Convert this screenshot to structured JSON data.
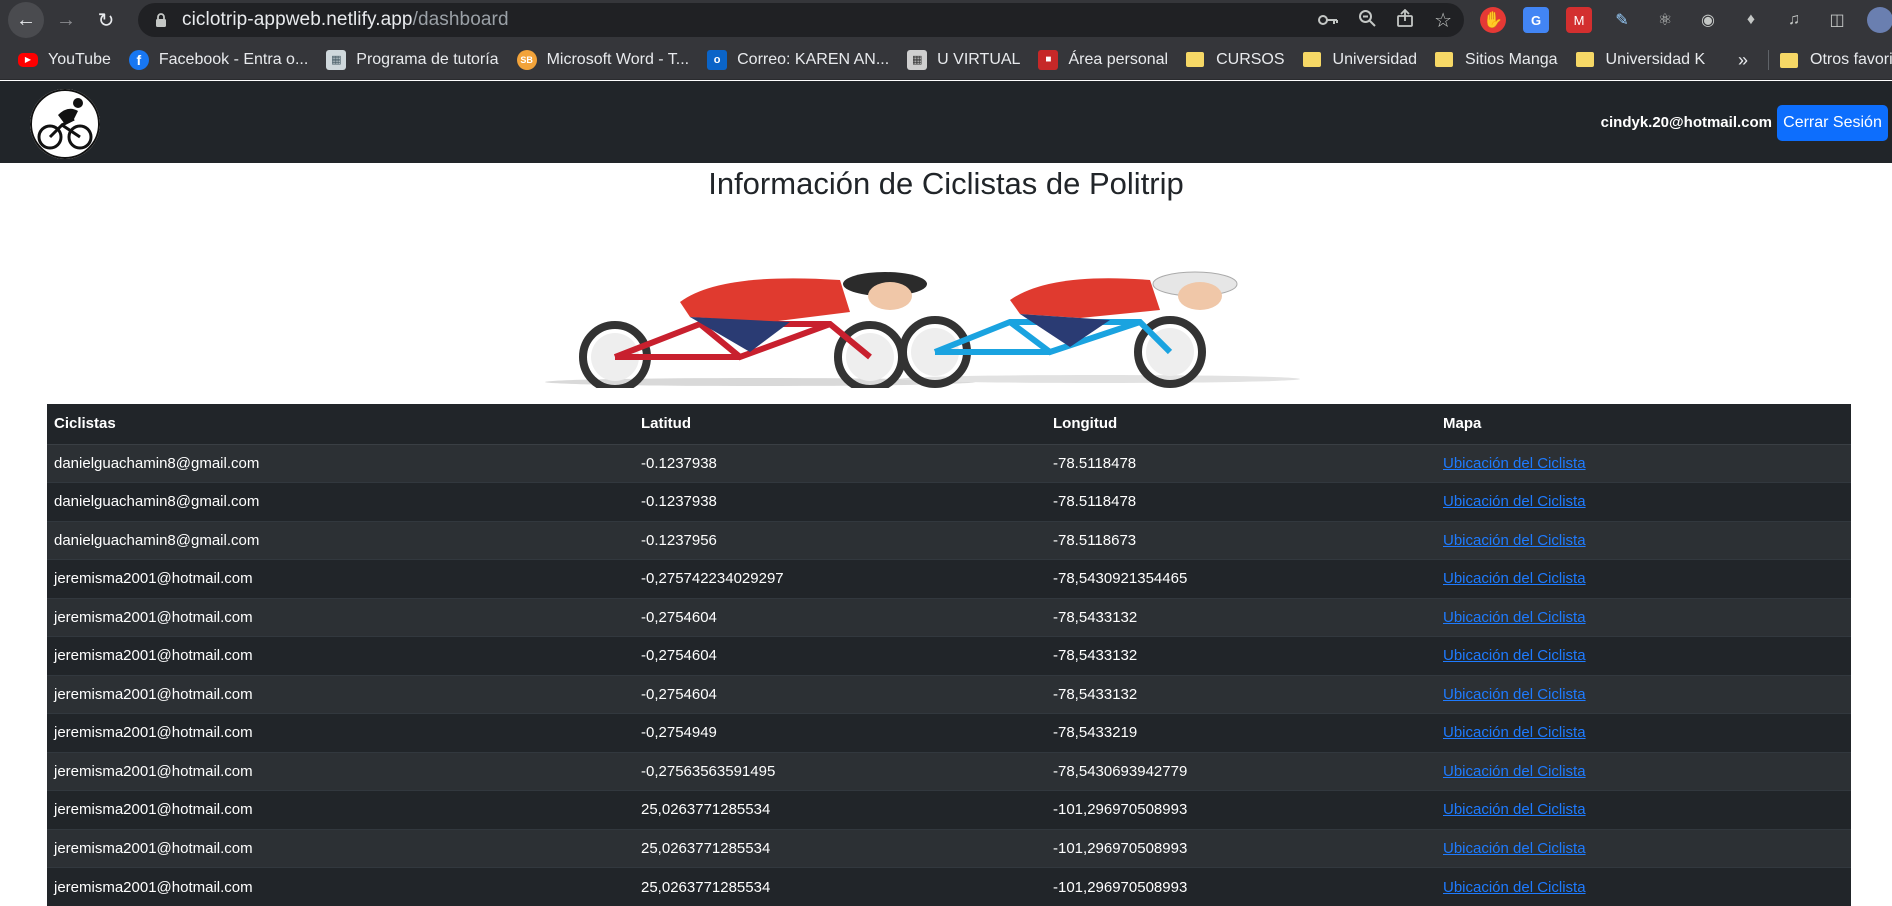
{
  "browser": {
    "url_host": "ciclotrip-appweb.netlify.app",
    "url_path": "/dashboard",
    "bookmarks": [
      {
        "label": "YouTube"
      },
      {
        "label": "Facebook - Entra o..."
      },
      {
        "label": "Programa de tutoría"
      },
      {
        "label": "Microsoft Word - T..."
      },
      {
        "label": "Correo: KAREN AN..."
      },
      {
        "label": "U VIRTUAL"
      },
      {
        "label": "Área personal"
      },
      {
        "label": "CURSOS"
      },
      {
        "label": "Universidad"
      },
      {
        "label": "Sitios Manga"
      },
      {
        "label": "Universidad K"
      }
    ],
    "more_bookmarks": "»",
    "other_bookmarks": "Otros favorit"
  },
  "navbar": {
    "user_email": "cindyk.20@hotmail.com",
    "logout_label": "Cerrar Sesión"
  },
  "main": {
    "title": "Información de Ciclistas de Politrip"
  },
  "table": {
    "headers": [
      "Ciclistas",
      "Latitud",
      "Longitud",
      "Mapa"
    ],
    "rows": [
      [
        "danielguachamin8@gmail.com",
        "-0.1237938",
        "-78.5118478",
        "Ubicación del Ciclista"
      ],
      [
        "danielguachamin8@gmail.com",
        "-0.1237938",
        "-78.5118478",
        "Ubicación del Ciclista"
      ],
      [
        "danielguachamin8@gmail.com",
        "-0.1237956",
        "-78.5118673",
        "Ubicación del Ciclista"
      ],
      [
        "jeremisma2001@hotmail.com",
        "-0,275742234029297",
        "-78,5430921354465",
        "Ubicación del Ciclista"
      ],
      [
        "jeremisma2001@hotmail.com",
        "-0,2754604",
        "-78,5433132",
        "Ubicación del Ciclista"
      ],
      [
        "jeremisma2001@hotmail.com",
        "-0,2754604",
        "-78,5433132",
        "Ubicación del Ciclista"
      ],
      [
        "jeremisma2001@hotmail.com",
        "-0,2754604",
        "-78,5433132",
        "Ubicación del Ciclista"
      ],
      [
        "jeremisma2001@hotmail.com",
        "-0,2754949",
        "-78,5433219",
        "Ubicación del Ciclista"
      ],
      [
        "jeremisma2001@hotmail.com",
        "-0,27563563591495",
        "-78,5430693942779",
        "Ubicación del Ciclista"
      ],
      [
        "jeremisma2001@hotmail.com",
        "25,0263771285534",
        "-101,296970508993",
        "Ubicación del Ciclista"
      ],
      [
        "jeremisma2001@hotmail.com",
        "25,0263771285534",
        "-101,296970508993",
        "Ubicación del Ciclista"
      ],
      [
        "jeremisma2001@hotmail.com",
        "25,0263771285534",
        "-101,296970508993",
        "Ubicación del Ciclista"
      ]
    ]
  },
  "colors": {
    "navbar_bg": "#212529",
    "accent": "#0d6efd",
    "link": "#1e7bff"
  }
}
